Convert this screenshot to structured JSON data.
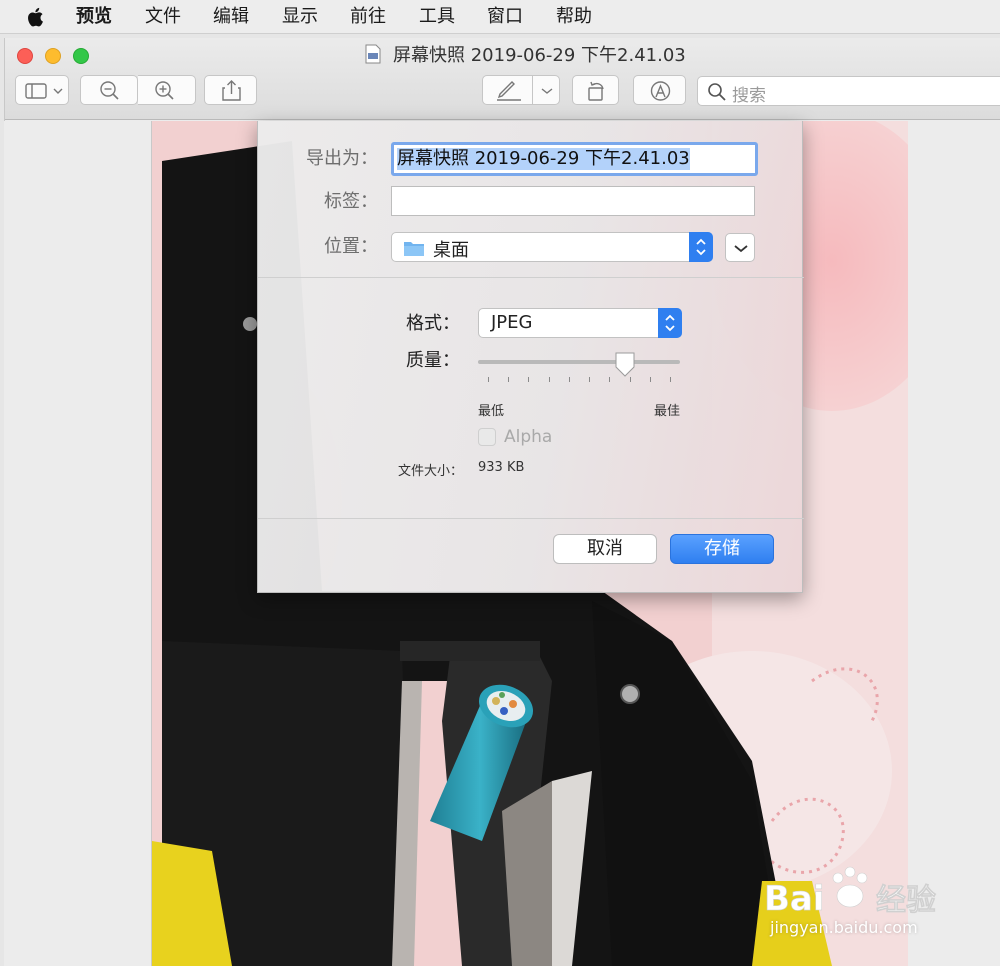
{
  "menubar": {
    "app_name": "预览",
    "items": [
      "文件",
      "编辑",
      "显示",
      "前往",
      "工具",
      "窗口",
      "帮助"
    ]
  },
  "window": {
    "title": "屏幕快照 2019-06-29 下午2.41.03",
    "search_placeholder": "搜索"
  },
  "export_dialog": {
    "export_as_label": "导出为：",
    "export_as_value": "屏幕快照 2019-06-29 下午2.41.03",
    "tags_label": "标签：",
    "tags_value": "",
    "location_label": "位置：",
    "location_value": "桌面",
    "format_label": "格式：",
    "format_value": "JPEG",
    "quality_label": "质量：",
    "quality_level": 0.75,
    "quality_min_label": "最低",
    "quality_max_label": "最佳",
    "alpha_label": "Alpha",
    "alpha_checked": false,
    "filesize_label": "文件大小：",
    "filesize_value": "933 KB",
    "cancel_label": "取消",
    "save_label": "存储"
  },
  "watermark": {
    "text": "jingyan.baidu.com"
  },
  "colors": {
    "accent": "#2f7ff0",
    "traffic_close": "#fc5f57",
    "traffic_min": "#fdbc2e",
    "traffic_max": "#33c748"
  }
}
